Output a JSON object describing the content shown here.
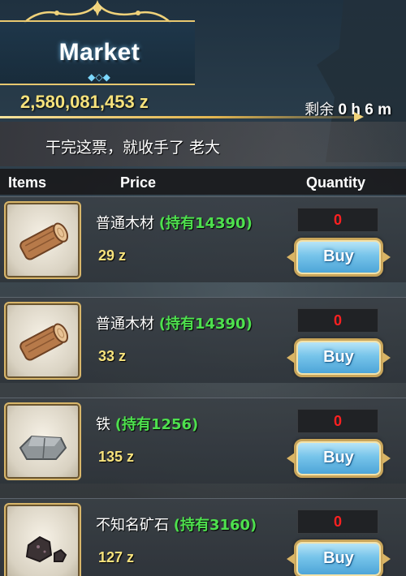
{
  "header": {
    "title": "Market",
    "currency": "2,580,081,453 z",
    "timer_label": "剩余",
    "timer_value": "0 h 6 m",
    "dialogue": "干完这票，就收手了 老大"
  },
  "columns": {
    "items": "Items",
    "price": "Price",
    "quantity": "Quantity"
  },
  "rows": [
    {
      "name": "普通木材",
      "owned": "(持有14390)",
      "price": "29 z",
      "quantity": "0",
      "buy_label": "Buy",
      "icon": "wood-log-icon"
    },
    {
      "name": "普通木材",
      "owned": "(持有14390)",
      "price": "33 z",
      "quantity": "0",
      "buy_label": "Buy",
      "icon": "wood-log-icon"
    },
    {
      "name": "铁",
      "owned": "(持有1256)",
      "price": "135 z",
      "quantity": "0",
      "buy_label": "Buy",
      "icon": "iron-ingot-icon"
    },
    {
      "name": "不知名矿石",
      "owned": "(持有3160)",
      "price": "127 z",
      "quantity": "0",
      "buy_label": "Buy",
      "icon": "ore-rock-icon"
    }
  ],
  "colors": {
    "gold": "#f6e27c",
    "owned_green": "#4ee04e",
    "quantity_red": "#ff2020",
    "buy_blue": "#76c4ea"
  }
}
